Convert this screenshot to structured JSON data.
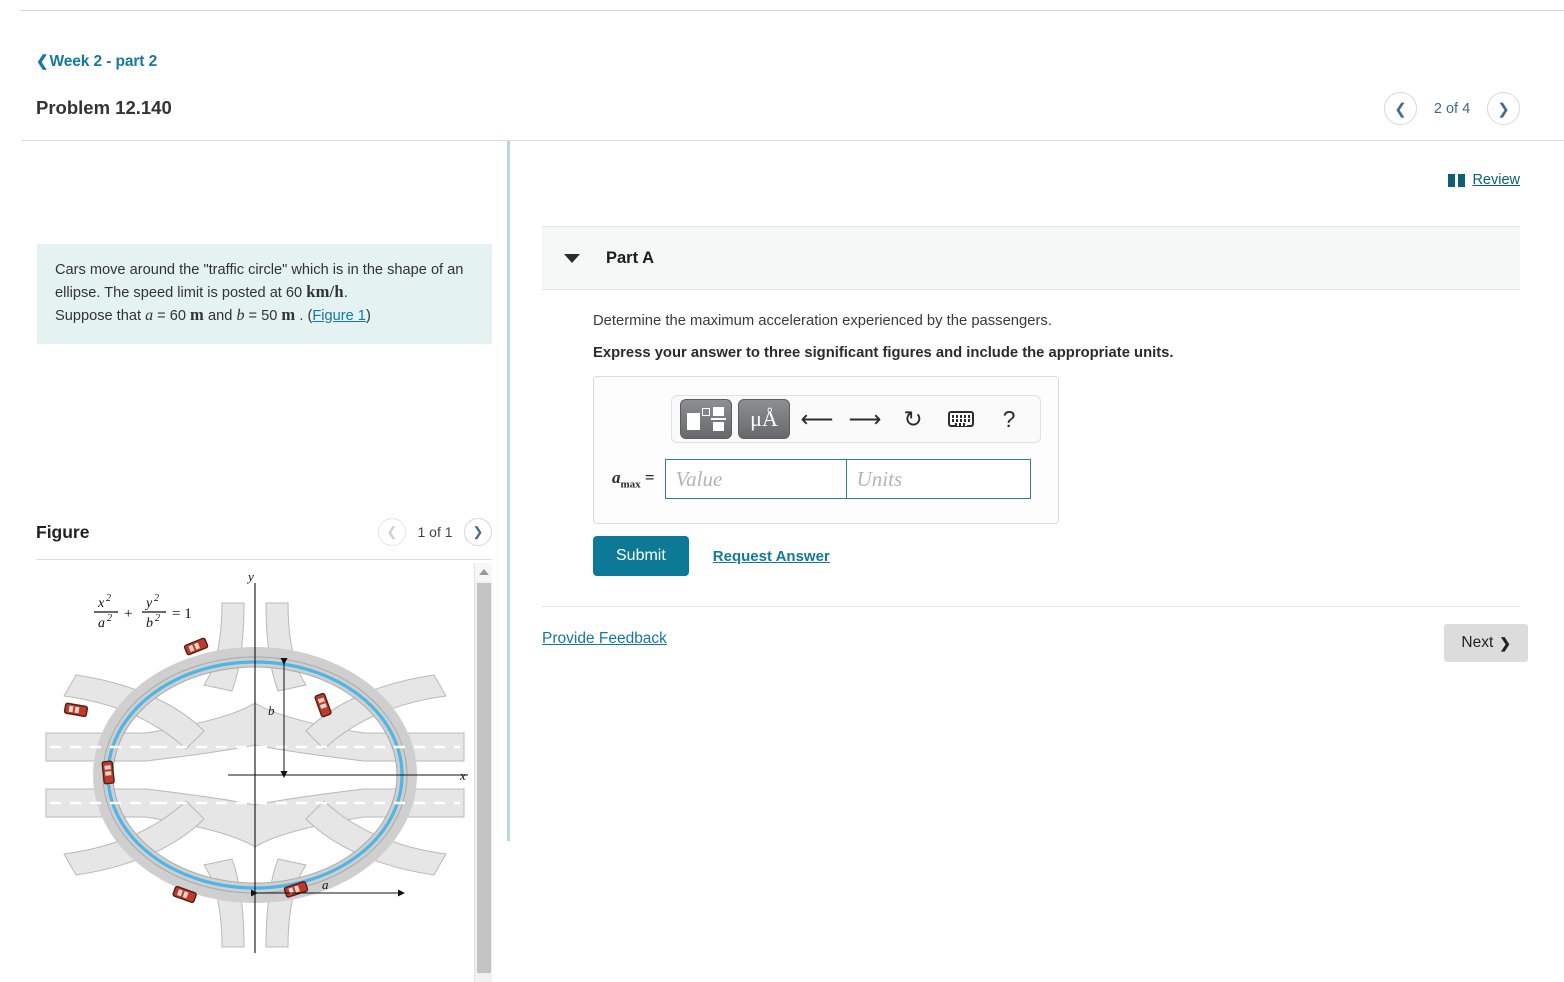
{
  "header": {
    "breadcrumb": "Week 2 - part 2",
    "breadcrumb_icon": "chevron-left-icon",
    "title": "Problem 12.140",
    "pager": {
      "prev_icon": "chevron-left-icon",
      "next_icon": "chevron-right-icon",
      "label": "2 of 4"
    }
  },
  "left": {
    "statement": {
      "line1": "Cars move around the \"traffic circle\" which is in the shape",
      "line2_a": "of an ellipse. The speed limit is posted at 60",
      "line2_unit": "km/h",
      "line2_end": ".",
      "line3_pre": "Suppose that",
      "var_a": "a",
      "eq1": "= 60",
      "unit_m1": "m",
      "and": "and",
      "var_b": "b",
      "eq2": "= 50",
      "unit_m2": "m",
      "period": ". (",
      "figure_link": "Figure 1",
      "close_paren": ")"
    },
    "figure": {
      "title": "Figure",
      "pager": {
        "prev_icon": "chevron-left-icon",
        "next_icon": "chevron-right-icon",
        "label": "1 of 1"
      },
      "equation": "x²/a² + y²/b² = 1",
      "axis_y": "y",
      "axis_x": "x",
      "dim_a": "a",
      "dim_b": "b",
      "scrollbar": {
        "up_icon": "triangle-up-icon"
      }
    }
  },
  "right": {
    "review": {
      "icon": "book-icon",
      "label": "Review"
    },
    "part": {
      "caret_icon": "triangle-down-icon",
      "label": "Part A"
    },
    "question": "Determine the maximum acceleration experienced by the passengers.",
    "instruction": "Express your answer to three significant figures and include the appropriate units.",
    "toolbar": {
      "template_button": "math-template-icon",
      "units_button": "μÅ",
      "undo_icon": "undo-arrow-icon",
      "redo_icon": "redo-arrow-icon",
      "reset_icon": "reset-circular-arrow-icon",
      "keyboard_icon": "keyboard-icon",
      "help_label": "?"
    },
    "answer": {
      "label_var": "a",
      "label_sub": "max",
      "label_eq": "=",
      "value_placeholder": "Value",
      "value": "",
      "units_placeholder": "Units",
      "units": ""
    },
    "submit_label": "Submit",
    "request_answer_label": "Request Answer",
    "provide_feedback_label": "Provide Feedback",
    "next_label": "Next",
    "next_icon": "chevron-right-icon"
  },
  "colors": {
    "accent_teal": "#0c7a96",
    "link_blue": "#1578a0",
    "statement_bg": "#e4f2f1",
    "part_header_bg": "#f5f6f6",
    "divider_blue": "#bfd4e2"
  }
}
